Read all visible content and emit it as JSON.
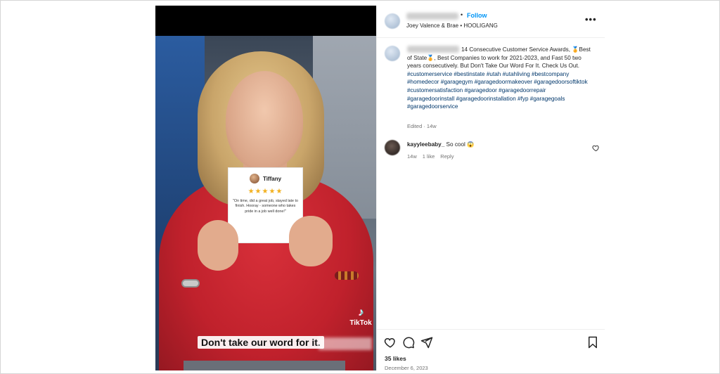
{
  "post": {
    "header": {
      "follow_label": "Follow",
      "separator": "•",
      "subtitle": "Joey Valence & Brae • HOOLIGANG",
      "more_label": "•••"
    },
    "caption": {
      "text": "14 Consecutive Customer Service Awards, 🏅Best of State🏅, Best Companies to work for 2021-2023, and Fast 50 two years consecutively. But Don't Take Our Word For It. Check Us Out.",
      "hashtags": "#customerservice #bestinstate #utah #utahliving #bestcompany #homedecor #garagegym #garagedoormakeover #garagedoorsoftiktok #customersatisfaction #garagedoor #garagedoorrepair #garagedoorinstall #garagedoorinstallation #fyp #garagegoals #garagedoorservice",
      "edited": "Edited · 14w"
    },
    "comment": {
      "username": "kayyleebaby_",
      "text": "So cool 😱",
      "age": "14w",
      "likes": "1 like",
      "reply_label": "Reply"
    },
    "footer": {
      "likes": "35 likes",
      "date": "December 6, 2023"
    }
  },
  "media": {
    "review_card": {
      "name": "Tiffany",
      "stars": "★★★★★",
      "quote": "\"On time, did a great job, stayed late to finish. Hooray - someone who takes pride in a job well done!\""
    },
    "tiktok_label": "TikTok",
    "video_caption": "Don't take our word for it."
  },
  "icons": {
    "tiktok": "tiktok-logo-icon",
    "heart": "heart-icon",
    "comment": "comment-icon",
    "share": "share-icon",
    "bookmark": "bookmark-icon"
  },
  "colors": {
    "link": "#0095f6",
    "hashtag": "#00376b",
    "muted": "#737373",
    "star": "#f2b01e",
    "sweater": "#c0212c"
  }
}
